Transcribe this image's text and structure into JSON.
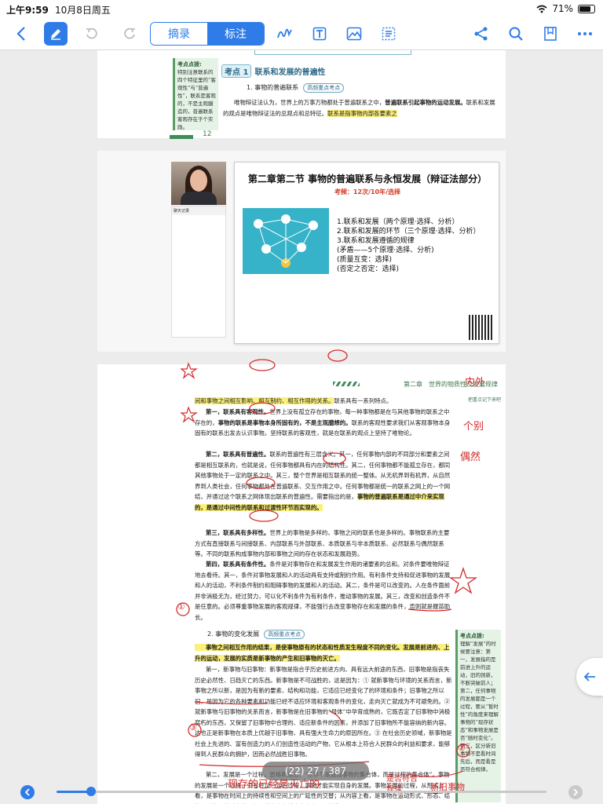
{
  "status": {
    "time": "上午9:59",
    "date": "10月8日周五",
    "battery": "71%"
  },
  "toolbar": {
    "tab_abstract": "摘录",
    "tab_annotate": "标注"
  },
  "page1": {
    "side_title": "考点点拨:",
    "side_text": "特别注意联系的四个特征里的“客观性”与“普遍性”，联系是客观的，不是主观臆造的，普遍联系客观存在于个实践。",
    "kd_tag": "考点 1",
    "kd_title": "联系和发展的普遍性",
    "sub1": "1. 事物的普遍联系",
    "badge": "高频重点考点",
    "text_a": "唯物辩证法认为，世界上的万事万物都处于普遍联系之中，",
    "text_b": "普遍联系引起事物的运动发展。",
    "text_c": "联系和发展的观点是唯物辩证法的总观点和总特征。",
    "text_d": "联系是指事物内部各要素之",
    "page_number": "12"
  },
  "page2": {
    "panel_title": "聊天记录",
    "slide_title": "第二章第二节 事物的普遍联系与永恒发展（辩证法部分）",
    "slide_sub": "考频：12次/10年/选择",
    "items": [
      "1.联系和发展（两个原理·选择、分析）",
      "2.联系和发展的环节（三个原理·选择、分析）",
      "3.联系和发展遵循的规律",
      "(矛盾——5个原理·选择、分析)",
      "(质量互变：选择)",
      "(否定之否定：选择)"
    ]
  },
  "page3": {
    "chapter_header": "第二章　世界的物质性及发展规律",
    "annot_link": "把重点记下来吧",
    "line0_hl": "间和事物之间相互影响、相互制约、相互作用的关系。",
    "line0_rest": "联系具有一系列特点。",
    "p1_lead": "第一，联系具有客观性。",
    "p1_a": "世界上没有孤立存在的事物，每一种事物都是在与其他事物的联系之中存在的，",
    "p1_hl": "事物的联系是事物本身所固有的，不是主观臆想的。",
    "p1_b": "联系的客观性要求我们从客观事物本身固有的联系出发去认识事物。坚持联系的客观性，就是在联系的观点上坚持了唯物论。",
    "p2_lead": "第二，联系具有普遍性。",
    "p2_a": "联系的普遍性有三层含义。其一，任何事物内部的不同部分和要素之间都是相互联系的，也就是说，任何事物都具有内在的结构性。其二，任何事物都不能孤立存在，都同其他事物处于一定的联系之中。其三，整个世界是相互联系的统一整体。从无机界到有机界，从自然界到人类社会，任何事物都处在普遍联系、交互作用之中。任何事物都是统一的联系之网上的一个网结，并通过这个联系之网体现出联系的普遍性。需要指出的是，",
    "p2_hl": "事物的普遍联系是通过中介来实现的，是通过中间性的联系和过渡性环节而实现的。",
    "p3_lead": "第三，联系具有多样性。",
    "p3_a": "世界上的事物是多样的，事物之间的联系也是多样的。事物联系的主要方式有直接联系与间接联系、内部联系与外部联系、本质联系与非本质联系、必然联系与偶然联系等。不同的联系构成事物内部和事物之间的存在状态和发展趋势。",
    "p4_lead": "第四，联系具有条件性。",
    "p4_a": "条件是对事物存在和发展发生作用的诸要素的总和。对条件要唯物辩证地去看待。其一，条件对事物发展和人的活动具有支持或制约作用。有利条件支持和促进事物的发展和人的活动，不利条件制约和阻碍事物的发展和人的活动。其二，条件是可以改变的。人在条件面前并非消极无为，经过努力，可以化不利条件为有利条件，推动事物的发展。其三，改变和创造条件不是任意的。必须尊重事物发展的客观规律，不能强行去改变事物存在和发展的条件，否则就是揠苗助长。",
    "sub2": "2. 事物的变化发展",
    "badge2": "高频重点考点",
    "p5_hl": "事物之间相互作用的结果，是使事物原有的状态和性质发生程度不同的变化。发展是前进的、上升的运动，发展的实质是新事物的产生和旧事物的灭亡。",
    "p6_a": "第一，新事物与旧事物：新事物是指合乎历史前进方向、具有远大前途的东西，旧事物是指丧失历史必然性、日趋灭亡的东西。新事物是不可战胜的，这是因为：① 就新事物与环境的关系而言，新事物之所以新，是因为有新的要素、结构和功能，它适应已经变化了的环境和条件；旧事物之所以旧，是因为它的各种要素和功能已经不适应环境和客观条件的变化，走向灭亡就成为不可避免的。② 就新事物与旧事物的关系而言，新事物是在旧事物的“母体”中孕育成熟的，它既否定了旧事物中消极腐朽的东西，又保留了旧事物中合理的、适应新条件的因素，并添加了旧事物所不能容纳的新内容。这也正是新事物在本质上优越于旧事物、具有强大生命力的原因所在。③ 在社会历史领域，新事物是社会上先进的、富有创造力的人们创造性活动的产物，它从根本上符合人民群众的利益和要求，能够得到人民群众的拥护，因而必然战胜旧事物。",
    "p7_a": "第二，发展是一个过程。恩格斯指出，“世界不是既成事物的集合体，而是过程的集合体”。事物的发展是一个过程，只有经过一定的过程，事物才能实现自身的发展。事物发展的过程，从形式上看，是事物在时间上的持续性和空间上的广延性的交替；从内容上看，是事物在运动形式、形态、结构、功能和关系上的更新。社会主义社会本身也是不断发展",
    "side2_title": "考点点拨:",
    "side2_text": "理解“发展”的时候要注意：第一，发展指的是前进上升的运动，旧的则新，不断突破前人；第二，任何事物的发展都是一个过程，要从“暂时性”的角度来理解事物的“现存状态”和事物发展是否“随时变化”。第三，区分新旧事物不是看时间先后，而是看是否符合规律。"
  },
  "handwriting": {
    "h1": "内外",
    "h2": "个别",
    "h3": "偶然",
    "h4": "①",
    "h5": "②",
    "h6": "③",
    "h7": "现存的已经是灭亡的",
    "h8": "是否符合规律",
    "h9": "新旧事物"
  },
  "viewer": {
    "page_indicator": "(22) 27 / 387",
    "progress": 0.07
  }
}
